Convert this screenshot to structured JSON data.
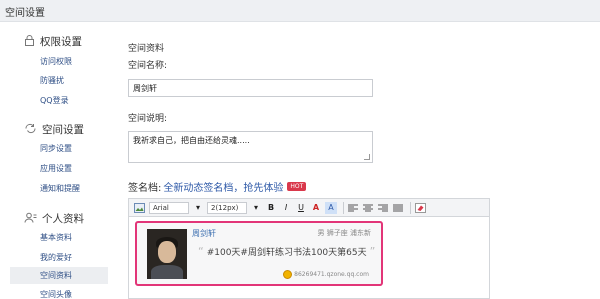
{
  "topbar": {
    "title": "空间设置"
  },
  "sidebar": {
    "sections": [
      {
        "title": "权限设置",
        "icon": "lock-icon",
        "items": [
          "访问权限",
          "防骚扰",
          "QQ登录"
        ]
      },
      {
        "title": "空间设置",
        "icon": "sync-icon",
        "items": [
          "同步设置",
          "应用设置",
          "通知和提醒"
        ]
      },
      {
        "title": "个人资料",
        "icon": "user-icon",
        "items": [
          "基本资料",
          "我的爱好",
          "空间资料",
          "空间头像"
        ]
      }
    ],
    "active_item": "空间资料"
  },
  "content": {
    "section_title": "空间资料",
    "name_label": "空间名称:",
    "name_value": "周剑轩",
    "desc_label": "空间说明:",
    "desc_value": "我祈求自己，把自由还给灵魂.....",
    "signature_label": "签名档:",
    "signature_link": "全新动态签名档，抢先体验",
    "hot_badge": "HOT"
  },
  "editor": {
    "font": "Arial",
    "size": "2(12px)",
    "bold": "B",
    "italic": "I",
    "underline": "U",
    "fontcolor": "A",
    "bgcolor": "A"
  },
  "card": {
    "name": "周剑轩",
    "meta": "男 狮子座 浦东新",
    "quote": "#100天#周剑轩练习书法100天第65天",
    "url": "86269471.qzone.qq.com"
  },
  "colors": {
    "highlight": "#e23578",
    "link": "#2f5aa8"
  }
}
